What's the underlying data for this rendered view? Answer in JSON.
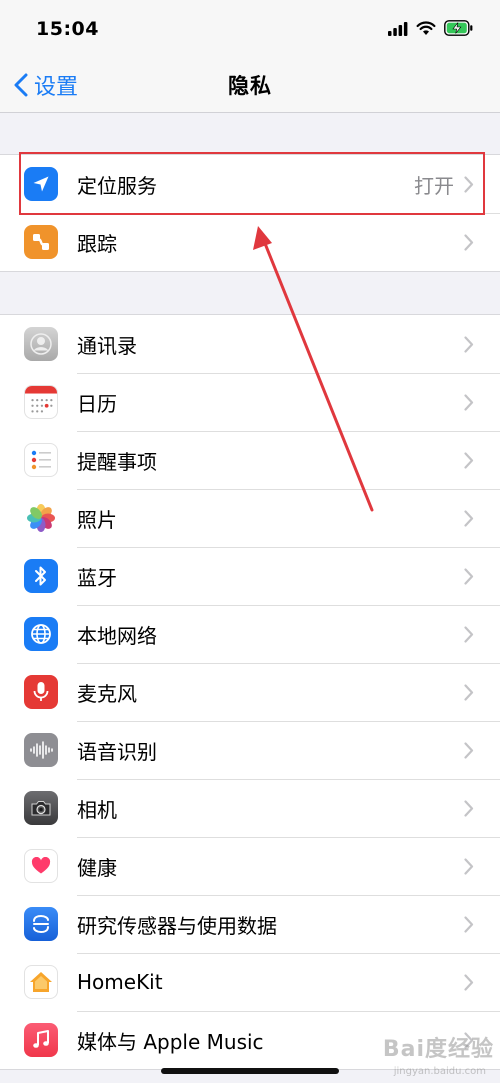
{
  "status_bar": {
    "time": "15:04"
  },
  "nav": {
    "back_label": "设置",
    "title": "隐私"
  },
  "group1": [
    {
      "label": "定位服务",
      "value": "打开",
      "icon": "location-arrow-icon",
      "color": "#1a7cf5"
    },
    {
      "label": "跟踪",
      "value": "",
      "icon": "tracking-icon",
      "color": "#f0932b"
    }
  ],
  "group2": [
    {
      "label": "通讯录",
      "icon": "contacts-icon",
      "color": "#bdbdbd"
    },
    {
      "label": "日历",
      "icon": "calendar-icon",
      "color": "#ffffff"
    },
    {
      "label": "提醒事项",
      "icon": "reminders-icon",
      "color": "#ffffff"
    },
    {
      "label": "照片",
      "icon": "photos-icon",
      "color": "#ffffff"
    },
    {
      "label": "蓝牙",
      "icon": "bluetooth-icon",
      "color": "#1a7cf5"
    },
    {
      "label": "本地网络",
      "icon": "globe-icon",
      "color": "#1a7cf5"
    },
    {
      "label": "麦克风",
      "icon": "microphone-icon",
      "color": "#e53935"
    },
    {
      "label": "语音识别",
      "icon": "waveform-icon",
      "color": "#8e8e93"
    },
    {
      "label": "相机",
      "icon": "camera-icon",
      "color": "#3a3a3c"
    },
    {
      "label": "健康",
      "icon": "health-heart-icon",
      "color": "#ffffff"
    },
    {
      "label": "研究传感器与使用数据",
      "icon": "research-icon",
      "color": "#1a7cf5"
    },
    {
      "label": "HomeKit",
      "icon": "home-icon",
      "color": "#ffffff"
    },
    {
      "label": "媒体与 Apple Music",
      "icon": "music-note-icon",
      "color": "#f0374b"
    }
  ],
  "watermark": {
    "text": "Bai度经验",
    "sub": "jingyan.baidu.com"
  }
}
